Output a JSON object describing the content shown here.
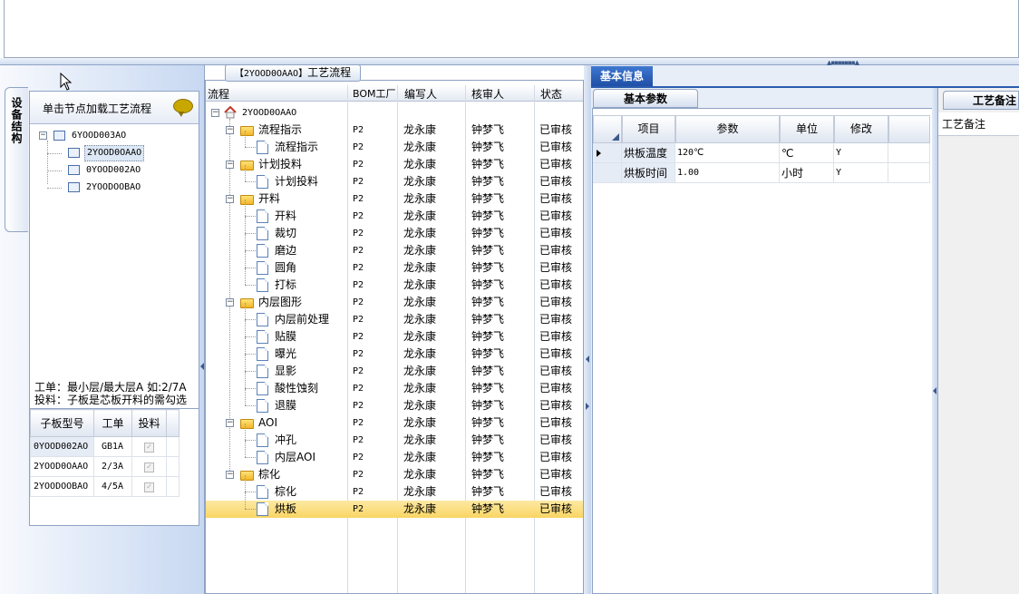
{
  "left": {
    "vtab_label": "设备结构",
    "header_text": "单击节点加载工艺流程",
    "tree": [
      {
        "label": "6YOOD003AO",
        "level": 0,
        "selected": false
      },
      {
        "label": "2YOOD0OAAO",
        "level": 1,
        "selected": true
      },
      {
        "label": "0YOOD002AO",
        "level": 1,
        "selected": false
      },
      {
        "label": "2YOODOOBAO",
        "level": 1,
        "selected": false
      }
    ],
    "hint_line1": "工单：最小层/最大层A 如:2/7A",
    "hint_line2": "投料：子板是芯板开料的需勾选",
    "grid_headers": [
      "子板型号",
      "工单",
      "投料"
    ],
    "grid_rows": [
      {
        "model": "0YOOD002AO",
        "order": "GB1A",
        "feed": "✓"
      },
      {
        "model": "2YOOD0OAAO",
        "order": "2/3A",
        "feed": "✓"
      },
      {
        "model": "2YOODOOBAO",
        "order": "4/5A",
        "feed": "✓"
      }
    ]
  },
  "middle": {
    "caption_code": "【2YOOD0OAAO】",
    "caption_text": "工艺流程",
    "headers": [
      "流程",
      "BOM工厂",
      "编写人",
      "核审人",
      "状态"
    ],
    "root_label": "2YOOD0OAAO",
    "rows": [
      {
        "name": "流程指示",
        "type": "folder",
        "level": 1,
        "bom": "P2",
        "writer": "龙永康",
        "reviewer": "钟梦飞",
        "status": "已审核"
      },
      {
        "name": "流程指示",
        "type": "doc",
        "level": 2,
        "bom": "P2",
        "writer": "龙永康",
        "reviewer": "钟梦飞",
        "status": "已审核"
      },
      {
        "name": "计划投料",
        "type": "folder",
        "level": 1,
        "bom": "P2",
        "writer": "龙永康",
        "reviewer": "钟梦飞",
        "status": "已审核"
      },
      {
        "name": "计划投料",
        "type": "doc",
        "level": 2,
        "bom": "P2",
        "writer": "龙永康",
        "reviewer": "钟梦飞",
        "status": "已审核"
      },
      {
        "name": "开料",
        "type": "folder",
        "level": 1,
        "bom": "P2",
        "writer": "龙永康",
        "reviewer": "钟梦飞",
        "status": "已审核"
      },
      {
        "name": "开料",
        "type": "doc",
        "level": 2,
        "bom": "P2",
        "writer": "龙永康",
        "reviewer": "钟梦飞",
        "status": "已审核"
      },
      {
        "name": "裁切",
        "type": "doc",
        "level": 2,
        "bom": "P2",
        "writer": "龙永康",
        "reviewer": "钟梦飞",
        "status": "已审核"
      },
      {
        "name": "磨边",
        "type": "doc",
        "level": 2,
        "bom": "P2",
        "writer": "龙永康",
        "reviewer": "钟梦飞",
        "status": "已审核"
      },
      {
        "name": "圆角",
        "type": "doc",
        "level": 2,
        "bom": "P2",
        "writer": "龙永康",
        "reviewer": "钟梦飞",
        "status": "已审核"
      },
      {
        "name": "打标",
        "type": "doc",
        "level": 2,
        "bom": "P2",
        "writer": "龙永康",
        "reviewer": "钟梦飞",
        "status": "已审核"
      },
      {
        "name": "内层图形",
        "type": "folder",
        "level": 1,
        "bom": "P2",
        "writer": "龙永康",
        "reviewer": "钟梦飞",
        "status": "已审核"
      },
      {
        "name": "内层前处理",
        "type": "doc",
        "level": 2,
        "bom": "P2",
        "writer": "龙永康",
        "reviewer": "钟梦飞",
        "status": "已审核"
      },
      {
        "name": "贴膜",
        "type": "doc",
        "level": 2,
        "bom": "P2",
        "writer": "龙永康",
        "reviewer": "钟梦飞",
        "status": "已审核"
      },
      {
        "name": "曝光",
        "type": "doc",
        "level": 2,
        "bom": "P2",
        "writer": "龙永康",
        "reviewer": "钟梦飞",
        "status": "已审核"
      },
      {
        "name": "显影",
        "type": "doc",
        "level": 2,
        "bom": "P2",
        "writer": "龙永康",
        "reviewer": "钟梦飞",
        "status": "已审核"
      },
      {
        "name": "酸性蚀刻",
        "type": "doc",
        "level": 2,
        "bom": "P2",
        "writer": "龙永康",
        "reviewer": "钟梦飞",
        "status": "已审核"
      },
      {
        "name": "退膜",
        "type": "doc",
        "level": 2,
        "bom": "P2",
        "writer": "龙永康",
        "reviewer": "钟梦飞",
        "status": "已审核"
      },
      {
        "name": "AOI",
        "type": "folder",
        "level": 1,
        "bom": "P2",
        "writer": "龙永康",
        "reviewer": "钟梦飞",
        "status": "已审核"
      },
      {
        "name": "冲孔",
        "type": "doc",
        "level": 2,
        "bom": "P2",
        "writer": "龙永康",
        "reviewer": "钟梦飞",
        "status": "已审核"
      },
      {
        "name": "内层AOI",
        "type": "doc",
        "level": 2,
        "bom": "P2",
        "writer": "龙永康",
        "reviewer": "钟梦飞",
        "status": "已审核"
      },
      {
        "name": "棕化",
        "type": "folder",
        "level": 1,
        "bom": "P2",
        "writer": "龙永康",
        "reviewer": "钟梦飞",
        "status": "已审核"
      },
      {
        "name": "棕化",
        "type": "doc",
        "level": 2,
        "bom": "P2",
        "writer": "龙永康",
        "reviewer": "钟梦飞",
        "status": "已审核"
      },
      {
        "name": "烘板",
        "type": "doc",
        "level": 2,
        "bom": "P2",
        "writer": "龙永康",
        "reviewer": "钟梦飞",
        "status": "已审核",
        "selected": true
      }
    ]
  },
  "right": {
    "main_tab": "基本信息",
    "sub_tab": "基本参数",
    "headers": [
      "项目",
      "参数",
      "单位",
      "修改"
    ],
    "rows": [
      {
        "item": "烘板温度",
        "param": "120℃",
        "unit": "℃",
        "edit": "Y",
        "current": true
      },
      {
        "item": "烘板时间",
        "param": "1.00",
        "unit": "小时",
        "edit": "Y",
        "current": false
      }
    ],
    "notes_tab": "工艺备注",
    "notes_header": "工艺备注"
  },
  "colors": {
    "accent": "#2b5cae",
    "selection": "#f9d564",
    "tree_selection": "#dde8f6"
  }
}
